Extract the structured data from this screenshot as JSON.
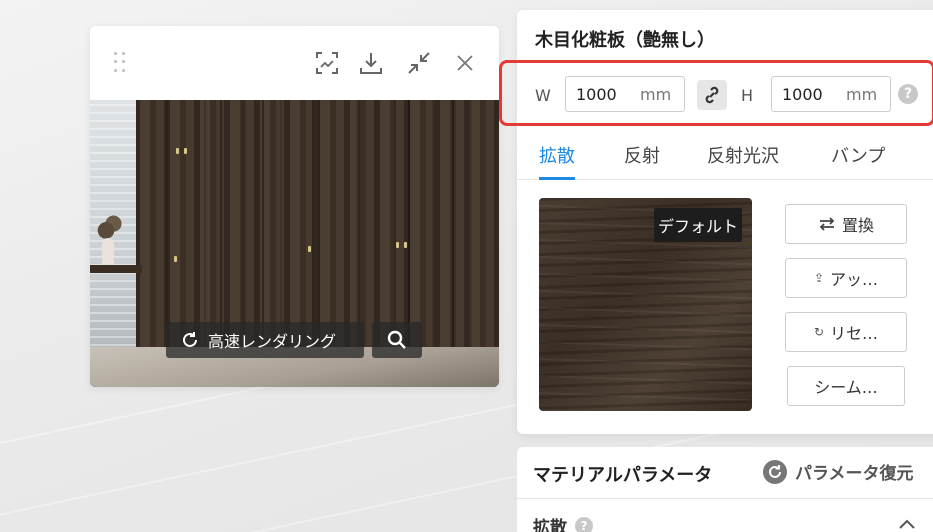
{
  "preview": {
    "render_label": "高速レンダリング"
  },
  "material": {
    "title": "木目化粧板（艶無し）",
    "width_label": "W",
    "width_value": "1000",
    "height_label": "H",
    "height_value": "1000",
    "unit": "mm",
    "help_glyph": "?",
    "tabs": [
      {
        "label": "拡散",
        "active": true
      },
      {
        "label": "反射"
      },
      {
        "label": "反射光沢"
      },
      {
        "label": "バンプ"
      }
    ],
    "texture_badge": "デフォルト",
    "buttons": {
      "replace": "置換",
      "upload": "アッ…",
      "reset": "リセ…",
      "seamless": "シーム…"
    }
  },
  "params": {
    "title": "マテリアルパラメータ",
    "restore_label": "パラメータ復元",
    "section_label": "拡散"
  },
  "colors": {
    "accent": "#1e88e5",
    "highlight": "#e53935"
  }
}
